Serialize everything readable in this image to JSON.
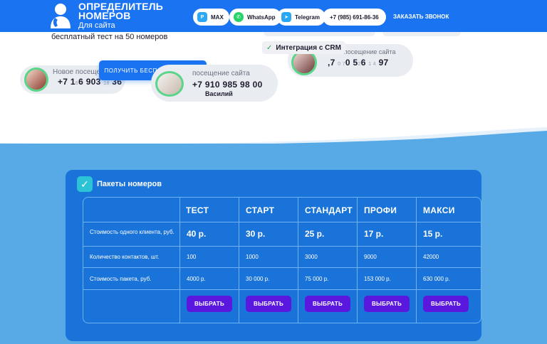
{
  "header": {
    "logo_title_line1": "ОПРЕДЕЛИТЕЛЬ",
    "logo_title_line2": "НОМЕРОВ",
    "logo_subtitle": "Для сайта",
    "contacts": [
      {
        "label": "MAX",
        "icon": "max-icon",
        "color": "#2aa8f5"
      },
      {
        "label": "WhatsApp",
        "icon": "whatsapp-icon",
        "color": "#25d366"
      },
      {
        "label": "Telegram",
        "icon": "telegram-icon",
        "color": "#2aa8f5"
      },
      {
        "label": "+7 (985) 691-86-36",
        "icon": "",
        "color": ""
      }
    ],
    "call_label": "ЗАКАЗАТЬ ЗВОНОК"
  },
  "hero": {
    "free_test": "бесплатный тест на 50 номеров",
    "cta": "ПОЛУЧИТЬ БЕСПЛАТНЫЙ ТЕСТ",
    "crm_badge": "Интеграция с CRM",
    "visitors": [
      {
        "label": "Новое посещение",
        "phone_a": "+7 1",
        "phone_b": "6 903 ",
        "phone_c": " 36",
        "small_a": "6",
        "small_b": "18"
      },
      {
        "label": "посещение сайта",
        "phone": "+7 910 985 98 00",
        "name": "Василий"
      },
      {
        "label": "Новое посещение сайта",
        "phone_a": ",7 ",
        "small_a": "0 7",
        "phone_b": "0 5",
        "small_b": "2",
        "phone_c": "6 ",
        "small_c": "1 4",
        "phone_d": " 97"
      }
    ]
  },
  "packages": {
    "title": "Пакеты номеров",
    "columns": [
      "ТЕСТ",
      "СТАРТ",
      "СТАНДАРТ",
      "ПРОФИ",
      "МАКСИ"
    ],
    "rows": [
      {
        "label": "Стоимость одного клиента, руб.",
        "values": [
          "40 р.",
          "30 р.",
          "25 р.",
          "17 р.",
          "15 р."
        ]
      },
      {
        "label": "Количество контактов, шт.",
        "values": [
          "100",
          "1000",
          "3000",
          "9000",
          "42000"
        ]
      },
      {
        "label": "Стоимость пакета, руб.",
        "values": [
          "4000 р.",
          "30 000 р.",
          "75 000 р.",
          "153 000 р.",
          "630 000 р."
        ]
      }
    ],
    "choose_label": "ВЫБРАТЬ"
  }
}
